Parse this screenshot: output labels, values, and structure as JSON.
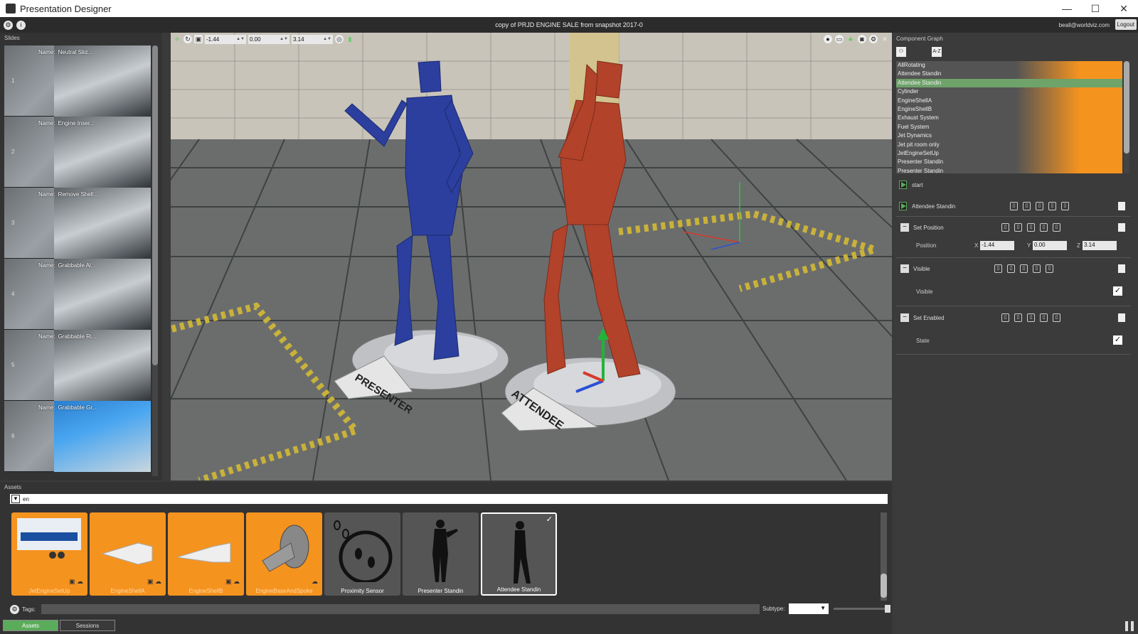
{
  "window": {
    "title": "Presentation Designer",
    "controls": [
      "—",
      "☐",
      "✕"
    ]
  },
  "toolbar": {
    "doc_title": "copy of PRJD ENGINE SALE from snapshot 2017-0",
    "user": "beall@worldviz.com",
    "logout": "Logout"
  },
  "slides": {
    "header": "Slides",
    "name_label": "Name:",
    "items": [
      {
        "num": "1",
        "name": "Neutral Slid..."
      },
      {
        "num": "2",
        "name": "Engine Inser..."
      },
      {
        "num": "3",
        "name": "Remove Shell..."
      },
      {
        "num": "4",
        "name": "Grabbable Al..."
      },
      {
        "num": "5",
        "name": "Grabbable Ri..."
      },
      {
        "num": "6",
        "name": "Grabbable Gr..."
      }
    ]
  },
  "viewport": {
    "x": "-1.44",
    "y": "0.00",
    "z": "3.14",
    "floor_labels": [
      "PRESENTER",
      "ATTENDEE"
    ]
  },
  "assets": {
    "header": "Assets",
    "filter_value": "en",
    "items": [
      {
        "label": "JetEngineSetUp",
        "style": "orange",
        "icon": "jet-engine-thumbnail"
      },
      {
        "label": "EngineShellA",
        "style": "orange",
        "icon": "engine-shell-thumbnail"
      },
      {
        "label": "EngineShellB",
        "style": "orange",
        "icon": "engine-shell-thumbnail"
      },
      {
        "label": "EngineBaseAndSpoke",
        "style": "orange",
        "icon": "engine-base-thumbnail"
      },
      {
        "label": "Proximity Sensor",
        "style": "gray",
        "icon": "footsteps-icon"
      },
      {
        "label": "Presenter Standin",
        "style": "gray",
        "icon": "presenter-silhouette-icon"
      },
      {
        "label": "Attendee Standin",
        "style": "gray",
        "icon": "attendee-silhouette-icon"
      }
    ],
    "tags_label": "Tags:",
    "subtype_label": "Subtype:",
    "tabs": [
      "Assets",
      "Sessions"
    ]
  },
  "component_graph": {
    "header": "Component Graph",
    "sort_label": "A-Z",
    "items": [
      "AllRotating",
      "Attendee Standin",
      "Attendee Standin",
      "Cylinder",
      "EngineShellA",
      "EngineShellB",
      "Exhaust System",
      "Fuel System",
      "Jet Dynamics",
      "Jet pit room only",
      "JetEngineSetUp",
      "Presenter Standin",
      "Presenter Standin"
    ],
    "selected_index": 2,
    "start_label": "start",
    "object_label": "Attendee Standin",
    "set_position": {
      "label": "Set Position",
      "position_label": "Position",
      "x_label": "X",
      "x": "-1.44",
      "y_label": "Y",
      "y": "0.00",
      "z_label": "Z",
      "z": "3.14"
    },
    "visible": {
      "label": "Visible",
      "field_label": "Visible",
      "checked": "✓"
    },
    "set_enabled": {
      "label": "Set Enabled",
      "field_label": "State",
      "checked": "✓"
    }
  }
}
